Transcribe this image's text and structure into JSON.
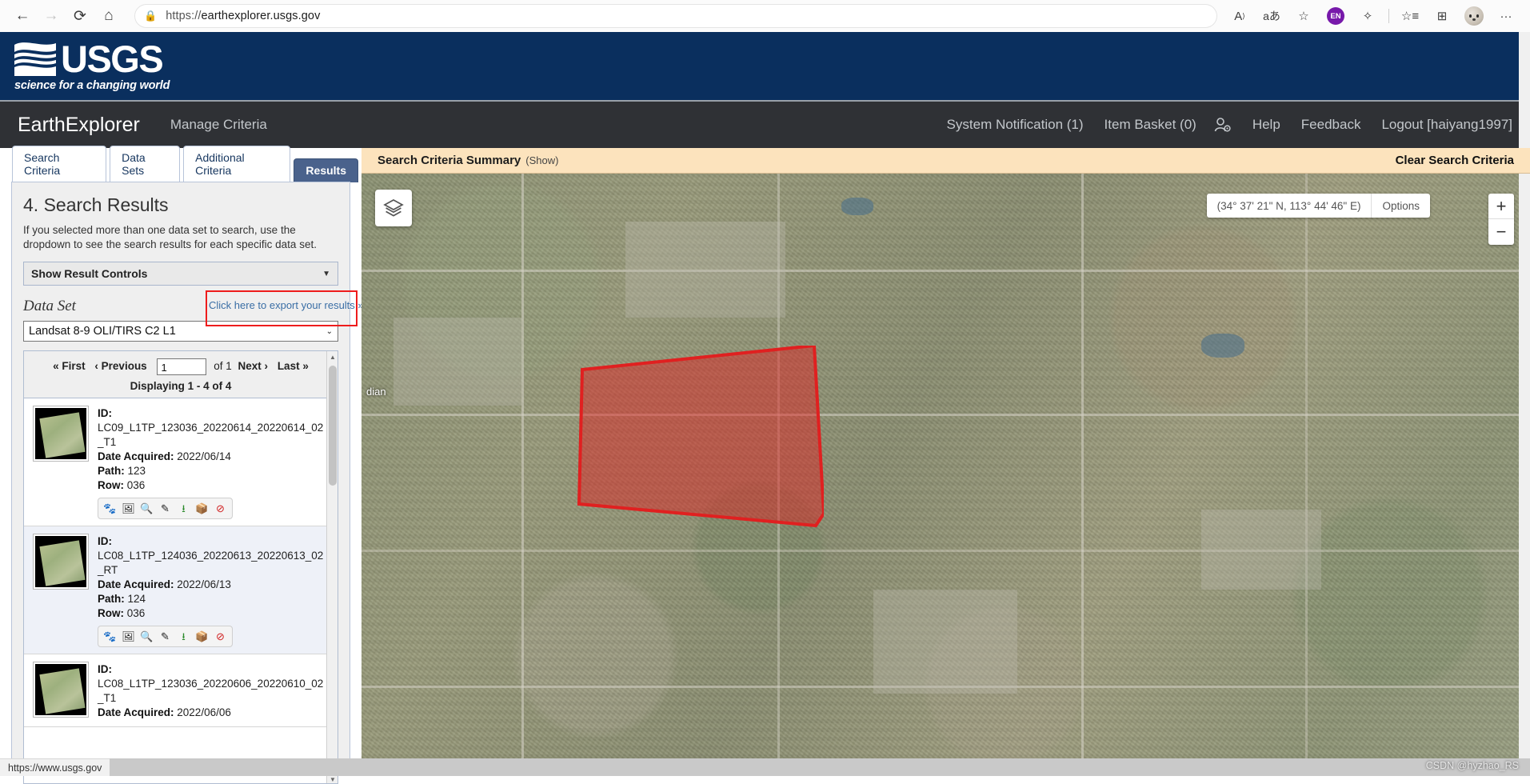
{
  "browser": {
    "back_icon": "back-arrow",
    "forward_icon": "forward-arrow",
    "reload_icon": "reload",
    "home_icon": "home",
    "lock_icon": "lock",
    "url_scheme": "https://",
    "url_domain": "earthexplorer.usgs.gov",
    "read_aloud_icon": "A",
    "translate_icon": "aあ",
    "add_favorite_icon": "favorite-add",
    "lang_badge": "EN",
    "extensions_icon": "extensions",
    "favorites_icon": "favorites-list",
    "collections_icon": "collections",
    "profile_icon": "profile-avatar",
    "settings_icon": "···"
  },
  "usgs": {
    "wordmark": "USGS",
    "tagline": "science for a changing world"
  },
  "nav": {
    "brand": "EarthExplorer",
    "manage_criteria": "Manage Criteria",
    "system_notification": "System Notification (1)",
    "item_basket": "Item Basket (0)",
    "user_icon": "user-gear-icon",
    "help": "Help",
    "feedback": "Feedback",
    "logout": "Logout [haiyang1997]"
  },
  "tabs": [
    {
      "label": "Search Criteria",
      "active": false
    },
    {
      "label": "Data Sets",
      "active": false
    },
    {
      "label": "Additional Criteria",
      "active": false
    },
    {
      "label": "Results",
      "active": true
    }
  ],
  "results_panel": {
    "title": "4. Search Results",
    "description": "If you selected more than one data set to search, use the dropdown to see the search results for each specific data set.",
    "result_controls_label": "Show Result Controls",
    "result_controls_caret": "▼",
    "dataset_label": "Data Set",
    "export_link": "Click here to export your results »",
    "export_icon": "external-link-icon",
    "dataset_value": "Landsat 8-9 OLI/TIRS C2 L1",
    "dataset_caret": "⌄",
    "pager": {
      "first": "« First",
      "previous": "‹ Previous",
      "page_value": "1",
      "of_text": "of 1",
      "next": "Next ›",
      "last": "Last »",
      "displaying": "Displaying 1 - 4 of 4"
    },
    "id_label": "ID:",
    "date_label": "Date Acquired:",
    "path_label": "Path:",
    "row_label": "Row:",
    "action_icons": [
      "footprint-icon",
      "browse-overlay-icon",
      "metadata-icon",
      "compare-icon",
      "download-icon",
      "bulk-order-icon",
      "exclude-icon"
    ],
    "items": [
      {
        "id": "LC09_L1TP_123036_20220614_20220614_02_T1",
        "date_acquired": "2022/06/14",
        "path": "123",
        "row": "036"
      },
      {
        "id": "LC08_L1TP_124036_20220613_20220613_02_RT",
        "date_acquired": "2022/06/13",
        "path": "124",
        "row": "036"
      },
      {
        "id": "LC08_L1TP_123036_20220606_20220610_02_T1",
        "date_acquired": "2022/06/06",
        "path": "",
        "row": ""
      }
    ]
  },
  "map": {
    "criteria_summary_title": "Search Criteria Summary",
    "criteria_summary_show": "(Show)",
    "clear_search_criteria": "Clear Search Criteria",
    "layers_icon": "layers-icon",
    "coordinates": "(34° 37' 21\" N, 113° 44' 46\" E)",
    "options_button": "Options",
    "zoom_in": "+",
    "zoom_out": "−",
    "place_label": "dian",
    "aoi_color": "#e02020",
    "watermark": "CSDN @hyzhao_RS"
  },
  "status": {
    "link_preview": "https://www.usgs.gov"
  },
  "colors": {
    "usgs_blue": "#0a2f5e",
    "nav_dark": "#2f3135",
    "tab_active": "#4a628c",
    "criteria_bar": "#fce3bd",
    "link_blue": "#3a6ea5",
    "highlight_red": "#ee1c1c"
  }
}
